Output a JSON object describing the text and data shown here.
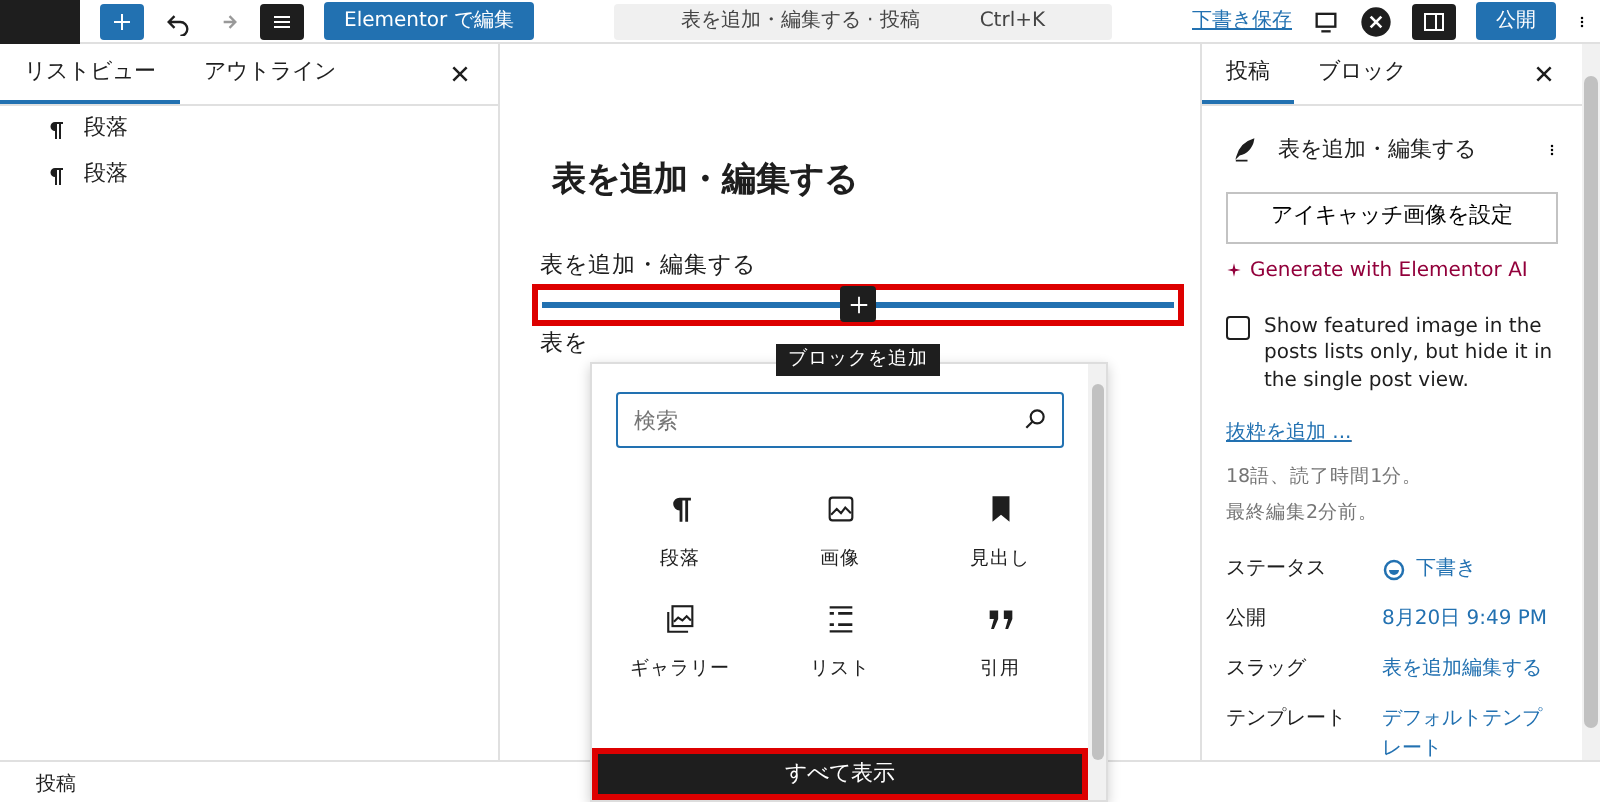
{
  "top_bar": {
    "edit_button": "Elementor で編集",
    "command": {
      "title": "表を追加・編集する · 投稿",
      "shortcut": "Ctrl+K"
    },
    "save_draft": "下書き保存",
    "publish": "公開"
  },
  "left_panel": {
    "tabs": [
      {
        "label": "リストビュー",
        "selected": true
      },
      {
        "label": "アウトライン",
        "selected": false
      }
    ],
    "items": [
      {
        "label": "段落"
      },
      {
        "label": "段落"
      }
    ]
  },
  "editor": {
    "title": "表を追加・編集する",
    "paragraphs": [
      "表を追加・編集する",
      "表を"
    ],
    "inserter_line": {
      "highlighted": true,
      "tooltip": "ブロックを追加"
    }
  },
  "inserter": {
    "search": {
      "placeholder": "検索"
    },
    "blocks": [
      {
        "label": "段落",
        "kind": "paragraph"
      },
      {
        "label": "画像",
        "kind": "image"
      },
      {
        "label": "見出し",
        "kind": "heading"
      },
      {
        "label": "ギャラリー",
        "kind": "gallery"
      },
      {
        "label": "リスト",
        "kind": "list"
      },
      {
        "label": "引用",
        "kind": "quote"
      }
    ],
    "browse_all": {
      "label": "すべて表示",
      "highlighted": true
    }
  },
  "right_panel": {
    "tabs": [
      {
        "label": "投稿",
        "selected": true
      },
      {
        "label": "ブロック",
        "selected": false
      }
    ],
    "post_title": "表を追加・編集する",
    "featured_image_button": "アイキャッチ画像を設定",
    "ai_link": "Generate with Elementor AI",
    "checkbox": {
      "label": "Show featured image in the posts lists only, but hide it in the single post view.",
      "checked": false
    },
    "excerpt_link": "抜粋を追加 ...",
    "stats": [
      "18語、読了時間1分。",
      "最終編集2分前。"
    ],
    "rows": [
      {
        "label": "ステータス",
        "value": "下書き",
        "kind": "status"
      },
      {
        "label": "公開",
        "value": "8月20日 9:49 PM",
        "kind": "link"
      },
      {
        "label": "スラッグ",
        "value": "表を追加編集する",
        "kind": "link"
      },
      {
        "label": "テンプレート",
        "value": "デフォルトテンプレート",
        "kind": "link"
      }
    ]
  },
  "footer": {
    "breadcrumb": "投稿"
  }
}
